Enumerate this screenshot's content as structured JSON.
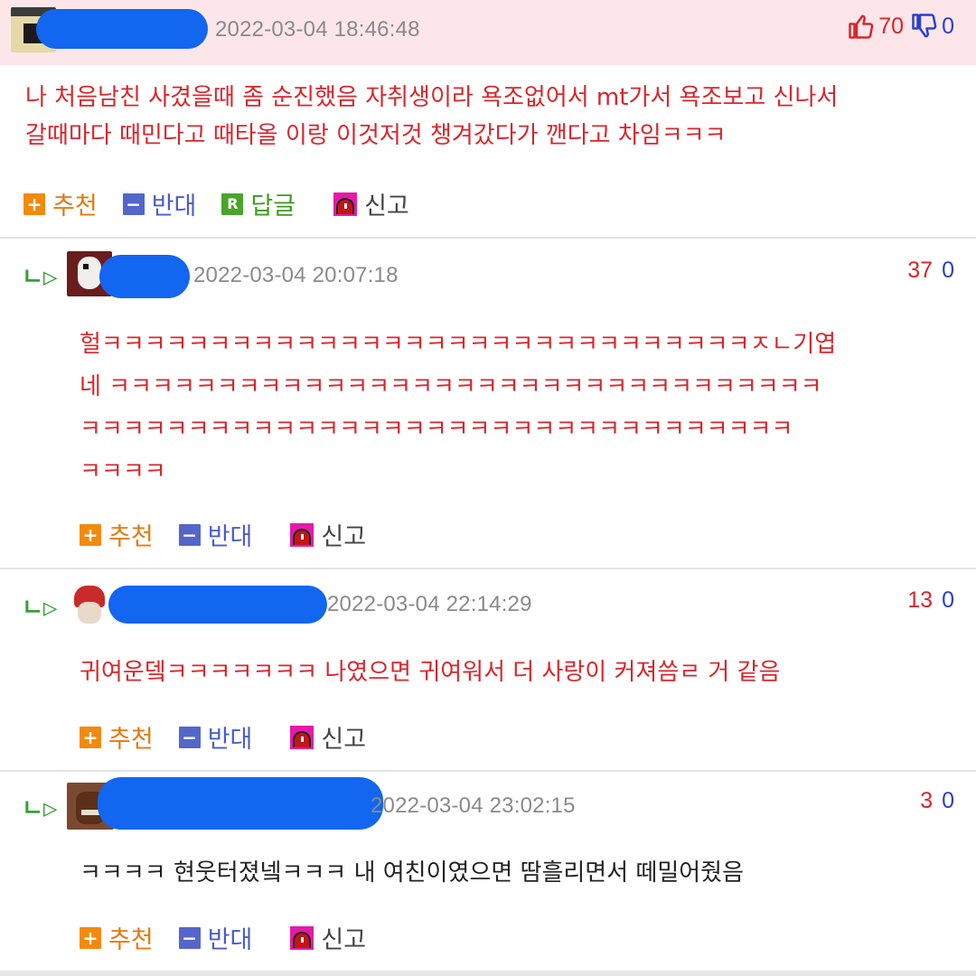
{
  "post": {
    "date": "2022-03-04 18:46:48",
    "up": "70",
    "down": "0",
    "lines": [
      "나 처음남친 사겼을때 좀 순진했음 자취생이라 욕조없어서 mt가서 욕조보고 신나서",
      "갈때마다 때민다고 때타올 이랑 이것저것 챙겨갔다가 깬다고 차임ㅋㅋㅋ"
    ],
    "actions": {
      "recommend": "추천",
      "oppose": "반대",
      "reply": "답글",
      "report": "신고"
    }
  },
  "replies": [
    {
      "date": "2022-03-04 20:07:18",
      "up": "37",
      "down": "0",
      "lines": [
        "헐ㅋㅋㅋㅋㅋㅋㅋㅋㅋㅋㅋㅋㅋㅋㅋㅋㅋㅋㅋㅋㅋㅋㅋㅋㅋㅋㅋㅋㅋㅋㅈㄴ기엽",
        "네 ㅋㅋㅋㅋㅋㅋㅋㅋㅋㅋㅋㅋㅋㅋㅋㅋㅋㅋㅋㅋㅋㅋㅋㅋㅋㅋㅋㅋㅋㅋㅋㅋㅋ",
        "ㅋㅋㅋㅋㅋㅋㅋㅋㅋㅋㅋㅋㅋㅋㅋㅋㅋㅋㅋㅋㅋㅋㅋㅋㅋㅋㅋㅋㅋㅋㅋㅋㅋ",
        "ㅋㅋㅋㅋ"
      ],
      "actions": {
        "recommend": "추천",
        "oppose": "반대",
        "report": "신고"
      }
    },
    {
      "date": "2022-03-04 22:14:29",
      "up": "13",
      "down": "0",
      "lines": [
        "귀여운뎈ㅋㅋㅋㅋㅋㅋㅋ 나였으면 귀여워서 더 사랑이 커져씀ㄹ 거 같음"
      ],
      "actions": {
        "recommend": "추천",
        "oppose": "반대",
        "report": "신고"
      }
    },
    {
      "date": "2022-03-04 23:02:15",
      "up": "3",
      "down": "0",
      "lines": [
        "ㅋㅋㅋㅋ 현웃터졌넼ㅋㅋㅋ 내 여친이였으면 땀흘리면서 떼밀어줬음"
      ],
      "actions": {
        "recommend": "추천",
        "oppose": "반대",
        "report": "신고"
      }
    }
  ],
  "icons": {
    "reply_arrow": "ㄴ▷",
    "plus": "+",
    "minus": "−",
    "reply_badge": "R"
  },
  "colors": {
    "red_text": "#d8262c",
    "blue": "#2a3fcf",
    "green": "#3c9d3c",
    "orange": "#f18a0e",
    "header_bg": "#fde6ea",
    "blur": "#1266f0"
  }
}
